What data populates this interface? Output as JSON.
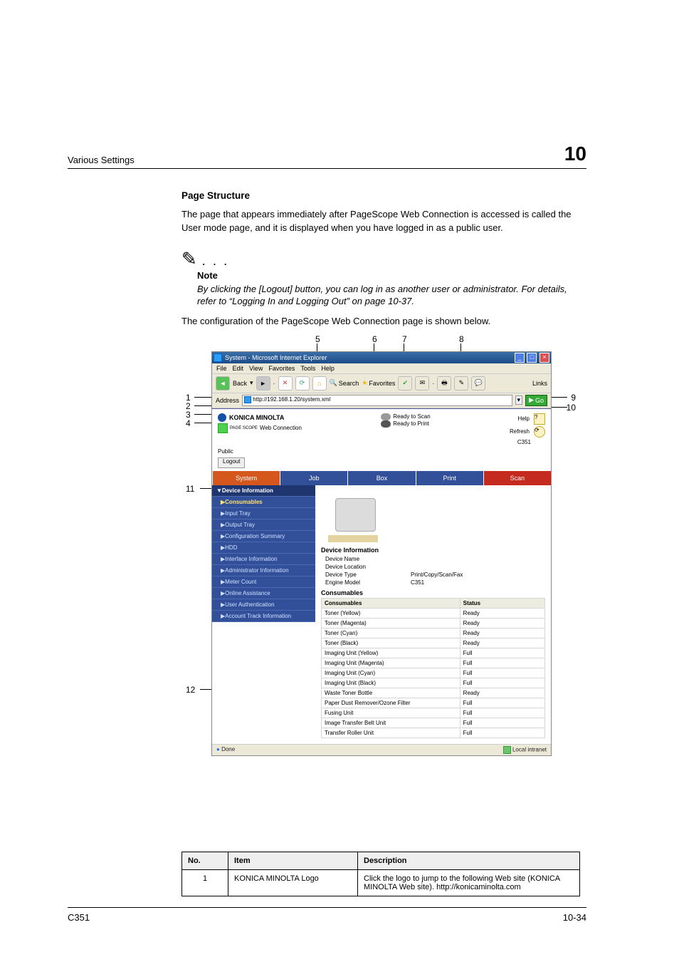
{
  "header": {
    "title": "Various Settings",
    "chapter": "10"
  },
  "section": {
    "heading": "Page Structure",
    "intro": "The page that appears immediately after PageScope Web Connection is accessed is called the User mode page, and it is displayed when you have logged in as a public user.",
    "note_label": "Note",
    "note_body": "By clicking the [Logout] button, you can log in as another user or administrator. For details, refer to “Logging In and Logging Out” on page 10-37.",
    "config_sentence": "The configuration of the PageScope Web Connection page is shown below."
  },
  "callouts": {
    "top": {
      "5": "5",
      "6": "6",
      "7": "7",
      "8": "8"
    },
    "left": {
      "1": "1",
      "2": "2",
      "3": "3",
      "4": "4",
      "11": "11",
      "12": "12"
    },
    "right": {
      "9": "9",
      "10": "10"
    }
  },
  "browser": {
    "title": "System - Microsoft Internet Explorer",
    "menus": [
      "File",
      "Edit",
      "View",
      "Favorites",
      "Tools",
      "Help"
    ],
    "back": "Back",
    "search": "Search",
    "favorites": "Favorites",
    "links": "Links",
    "address_label": "Address",
    "address_url": "http://192.168.1.20/system.xml",
    "go": "Go",
    "status_done": "Done",
    "status_zone": "Local intranet"
  },
  "psw": {
    "brand": "KONICA MINOLTA",
    "product_prefix": "PAGE SCOPE",
    "product": " Web Connection",
    "status_scan": "Ready to Scan",
    "status_print": "Ready to Print",
    "help": "Help",
    "refresh": "Refresh",
    "model": "C351",
    "login_mode": "Public",
    "logout": "Logout",
    "tabs": [
      "System",
      "Job",
      "Box",
      "Print",
      "Scan"
    ]
  },
  "sidebar": {
    "header": "▼Device Information",
    "items": [
      "▶Consumables",
      "▶Input Tray",
      "▶Output Tray",
      "▶Configuration Summary",
      "▶HDD",
      "▶Interface Information",
      "▶Administrator Information",
      "▶Meter Count",
      "▶Online Assistance",
      "▶User Authentication",
      "▶Account Track Information"
    ]
  },
  "devinfo": {
    "header": "Device Information",
    "rows": [
      {
        "k": "Device Name",
        "v": ""
      },
      {
        "k": "Device Location",
        "v": ""
      },
      {
        "k": "Device Type",
        "v": "Print/Copy/Scan/Fax"
      },
      {
        "k": "Engine Model",
        "v": "C351"
      }
    ]
  },
  "consumables": {
    "header": "Consumables",
    "col1": "Consumables",
    "col2": "Status",
    "rows": [
      {
        "name": "Toner (Yellow)",
        "status": "Ready"
      },
      {
        "name": "Toner (Magenta)",
        "status": "Ready"
      },
      {
        "name": "Toner (Cyan)",
        "status": "Ready"
      },
      {
        "name": "Toner (Black)",
        "status": "Ready"
      },
      {
        "name": "Imaging Unit (Yellow)",
        "status": "Full"
      },
      {
        "name": "Imaging Unit (Magenta)",
        "status": "Full"
      },
      {
        "name": "Imaging Unit (Cyan)",
        "status": "Full"
      },
      {
        "name": "Imaging Unit (Black)",
        "status": "Full"
      },
      {
        "name": "Waste Toner Bottle",
        "status": "Ready"
      },
      {
        "name": "Paper Dust Remover/Ozone Filter",
        "status": "Full"
      },
      {
        "name": "Fusing Unit",
        "status": "Full"
      },
      {
        "name": "Image Transfer Belt Unit",
        "status": "Full"
      },
      {
        "name": "Transfer Roller Unit",
        "status": "Full"
      }
    ]
  },
  "item_table": {
    "headers": {
      "no": "No.",
      "item": "Item",
      "desc": "Description"
    },
    "rows": [
      {
        "no": "1",
        "item": "KONICA MINOLTA Logo",
        "desc": "Click the logo to jump to the following Web site (KONICA MINOLTA Web site). http://konicaminolta.com"
      }
    ]
  },
  "footer": {
    "left": "C351",
    "right": "10-34"
  }
}
